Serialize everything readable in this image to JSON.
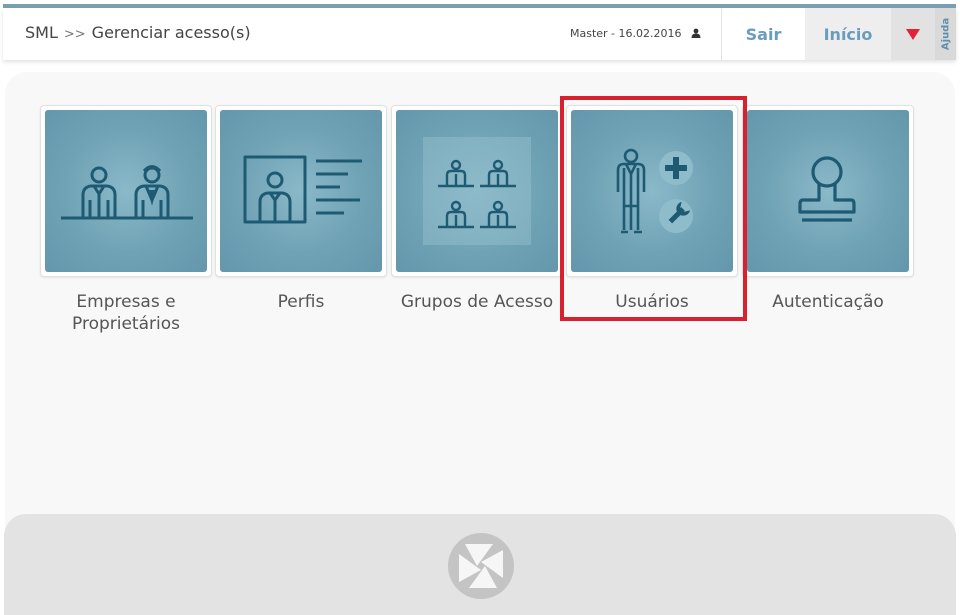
{
  "header": {
    "breadcrumb_root": "SML",
    "breadcrumb_sep": ">>",
    "breadcrumb_page": "Gerenciar acesso(s)",
    "user_info": "Master - 16.02.2016",
    "sair_label": "Sair",
    "inicio_label": "Início",
    "ajuda_label": "Ajuda"
  },
  "tiles": [
    {
      "label": "Empresas e Proprietários",
      "icon": "business-people-icon"
    },
    {
      "label": "Perfis",
      "icon": "profile-card-icon"
    },
    {
      "label": "Grupos de Acesso",
      "icon": "access-groups-icon"
    },
    {
      "label": "Usuários",
      "icon": "user-add-settings-icon"
    },
    {
      "label": "Autenticação",
      "icon": "stamp-icon"
    }
  ],
  "colors": {
    "accent": "#6a9cbc",
    "tile": "#6fa2b5",
    "icon": "#1f5a73",
    "highlight": "#d8212e",
    "menu_arrow": "#e3223a"
  }
}
